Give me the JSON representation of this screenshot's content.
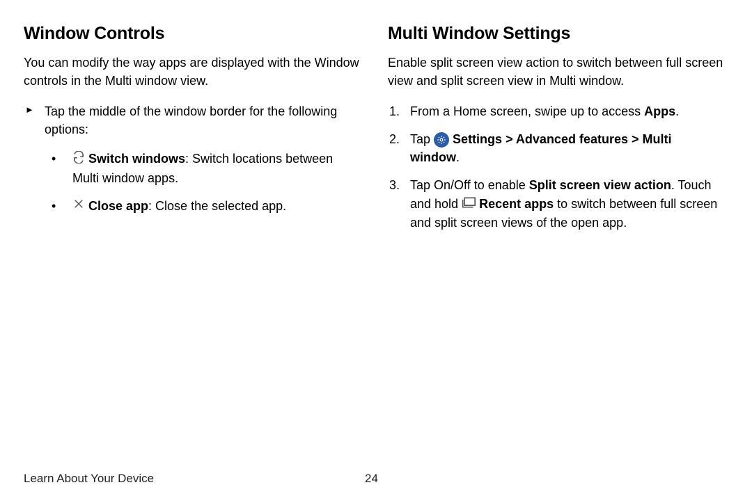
{
  "left": {
    "heading": "Window Controls",
    "intro": "You can modify the way apps are displayed with the Window controls in the Multi window view.",
    "lead": "Tap the middle of the window border for the following options:",
    "switch_b": "Switch windows",
    "switch_rest": ": Switch locations between Multi window apps.",
    "close_b": "Close app",
    "close_rest": ": Close the selected app."
  },
  "right": {
    "heading": "Multi Window Settings",
    "intro": "Enable split screen view action to switch between full screen view and split screen view in Multi window.",
    "s1a": "From a Home screen, swipe up to access ",
    "s1b": "Apps",
    "s1c": ".",
    "s2a": "Tap ",
    "s2b": "Settings",
    "gt1": " > ",
    "s2c": "Advanced features",
    "gt2": " > ",
    "s2d": "Multi window",
    "s2e": ".",
    "s3a": "Tap On/Off to enable ",
    "s3b": "Split screen view action",
    "s3c": ". Touch and hold ",
    "s3d": "Recent apps",
    "s3e": " to switch between full screen and split screen views of the open app."
  },
  "footer": {
    "section": "Learn About Your Device",
    "page": "24"
  }
}
